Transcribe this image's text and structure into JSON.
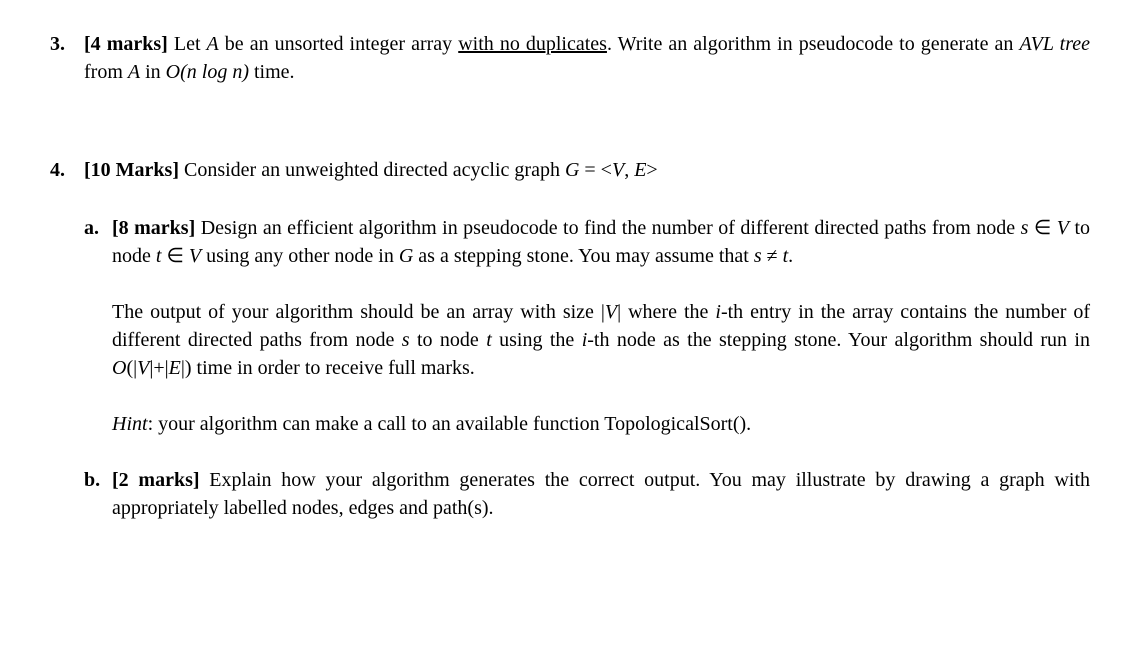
{
  "q3": {
    "number": "3.",
    "marks": "[4 marks]",
    "text_pre": " Let ",
    "var_A": "A",
    "text_mid1": " be an unsorted integer array ",
    "underlined": "with no duplicates",
    "text_mid2": ". Write an algorithm in pseudocode to generate an ",
    "avl": "AVL tree",
    "text_mid3": " from ",
    "var_A2": "A",
    "text_mid4": " in ",
    "complexity": "O(n log n)",
    "text_end": " time."
  },
  "q4": {
    "number": "4.",
    "marks": "[10 Marks]",
    "text_pre": " Consider an unweighted directed acyclic graph ",
    "var_G": "G",
    "eq": " = <",
    "var_V": "V",
    "comma": ", ",
    "var_E": "E",
    "close": ">",
    "a": {
      "label": "a.",
      "marks": "[8 marks]",
      "p1_1": " Design an efficient algorithm in pseudocode to find the number of different directed paths from node ",
      "var_s": "s",
      "elem1": " ∈ ",
      "var_V1": "V",
      "p1_2": " to node ",
      "var_t": "t",
      "elem2": " ∈ ",
      "var_V2": "V",
      "p1_3": " using any other node in ",
      "var_G": "G",
      "p1_4": " as a stepping stone. You may assume that ",
      "var_s2": "s",
      "neq": " ≠ ",
      "var_t2": "t",
      "p1_5": ".",
      "p2_1": "The output of your algorithm should be an array with size |",
      "var_V3": "V",
      "p2_2": "| where the ",
      "var_i": "i",
      "p2_3": "-th entry in the array contains the number of different directed paths from node ",
      "var_s3": "s",
      "p2_4": " to node ",
      "var_t3": "t",
      "p2_5": " using the ",
      "var_i2": "i",
      "p2_6": "-th node as the stepping stone. Your algorithm should run in ",
      "complexity": "O",
      "p2_7": "(|",
      "var_V4": "V",
      "p2_8": "|+|",
      "var_E": "E",
      "p2_9": "|) time in order to receive full marks.",
      "hint_label": "Hint",
      "hint_text": ": your algorithm can make a call to an available function TopologicalSort()."
    },
    "b": {
      "label": "b.",
      "marks": "[2 marks]",
      "text": " Explain how your algorithm generates the correct output. You may illustrate by drawing a graph with appropriately labelled nodes, edges and path(s)."
    }
  }
}
